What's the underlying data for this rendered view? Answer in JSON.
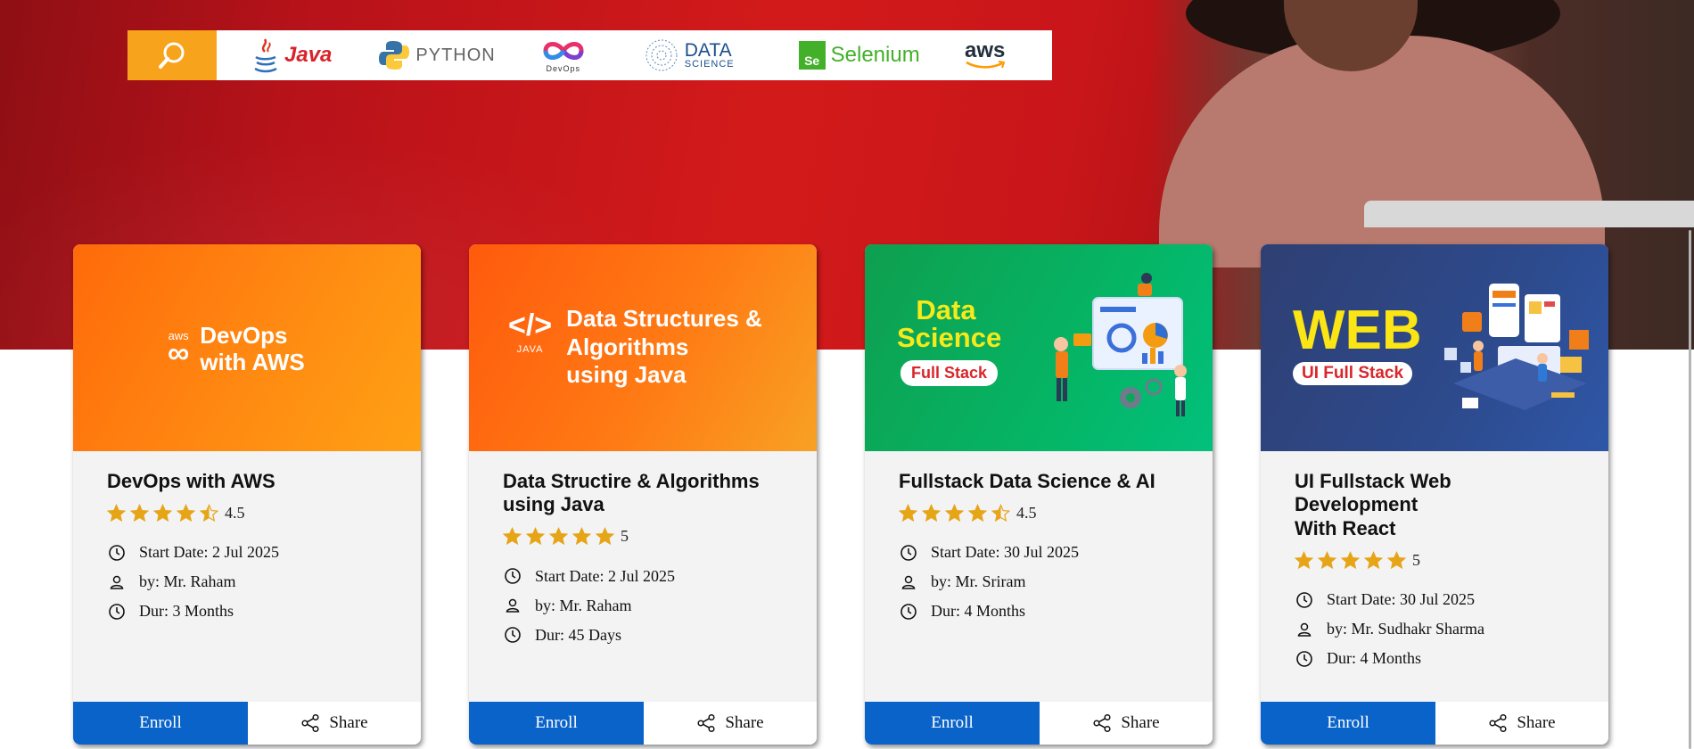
{
  "logos": {
    "java": "Java",
    "python": "PYTHON",
    "devops": "DevOps",
    "data_science_1": "DATA",
    "data_science_2": "SCIENCE",
    "selenium_box": "Se",
    "selenium": "Selenium",
    "aws": "aws"
  },
  "colors": {
    "accent_blue": "#0a63c9",
    "hero_red": "#d31a1a",
    "search_orange": "#f7a31b",
    "star_gold": "#e6a417"
  },
  "cards": [
    {
      "banner": {
        "icon_text": "aws",
        "title": "DevOps\nwith  AWS"
      },
      "title": "DevOps with AWS",
      "rating": 4.5,
      "rating_label": "4.5",
      "start_date": "Start Date: 2 Jul 2025",
      "instructor": "by: Mr. Raham",
      "duration": "Dur: 3 Months",
      "enroll_label": "Enroll",
      "share_label": "Share"
    },
    {
      "banner": {
        "icon_code": "</>",
        "icon_text": "JAVA",
        "title": "Data Structures &\nAlgorithms\nusing Java"
      },
      "title": "Data Structire & Algorithms\nusing Java",
      "rating": 5,
      "rating_label": "5",
      "start_date": "Start Date: 2 Jul 2025",
      "instructor": "by: Mr. Raham",
      "duration": "Dur: 45 Days",
      "enroll_label": "Enroll",
      "share_label": "Share"
    },
    {
      "banner": {
        "title": "Data\nScience",
        "pill": "Full Stack"
      },
      "title": "Fullstack Data Science & AI",
      "rating": 4.5,
      "rating_label": "4.5",
      "start_date": "Start Date: 30 Jul 2025",
      "instructor": "by: Mr. Sriram",
      "duration": "Dur: 4 Months",
      "enroll_label": "Enroll",
      "share_label": "Share"
    },
    {
      "banner": {
        "title": "WEB",
        "pill": "UI Full Stack"
      },
      "title": "UI Fullstack Web Development\nWith React",
      "rating": 5,
      "rating_label": "5",
      "start_date": "Start Date: 30 Jul 2025",
      "instructor": "by: Mr. Sudhakr Sharma",
      "duration": "Dur: 4 Months",
      "enroll_label": "Enroll",
      "share_label": "Share"
    }
  ]
}
